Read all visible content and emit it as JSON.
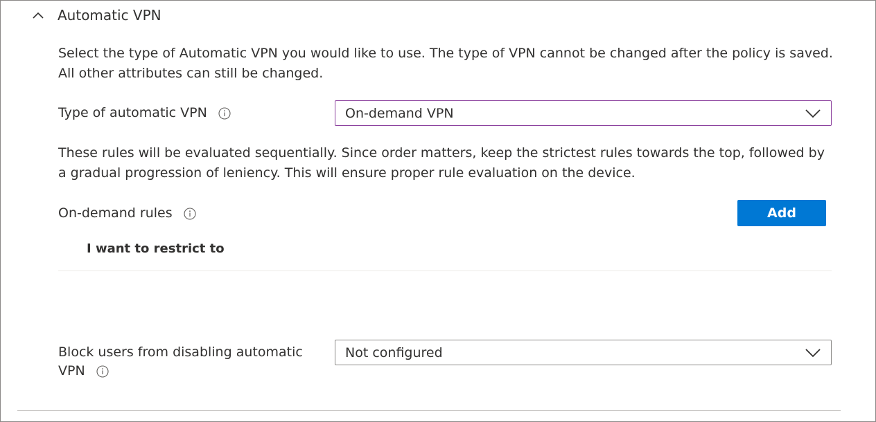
{
  "section": {
    "title": "Automatic VPN"
  },
  "intro_text": "Select the type of Automatic VPN you would like to use. The type of VPN cannot be changed after the policy is saved. All other attributes can still be changed.",
  "vpn_type": {
    "label": "Type of automatic VPN",
    "value": "On-demand VPN"
  },
  "rules_text": "These rules will be evaluated sequentially. Since order matters, keep the strictest rules towards the top, followed by a gradual progression of leniency. This will ensure proper rule evaluation on the device.",
  "on_demand_rules": {
    "label": "On-demand rules",
    "add_label": "Add",
    "column_header": "I want to restrict to"
  },
  "block_users": {
    "label_line1": "Block users from disabling automatic",
    "label_line2": "VPN",
    "value": "Not configured"
  },
  "icons": {
    "collapse": "chevron-up-icon",
    "info": "info-icon",
    "dropdown": "chevron-down-icon"
  },
  "colors": {
    "accent": "#0078d4",
    "focus_border": "#8a3e9c",
    "text": "#323130",
    "border": "#8a8886"
  }
}
